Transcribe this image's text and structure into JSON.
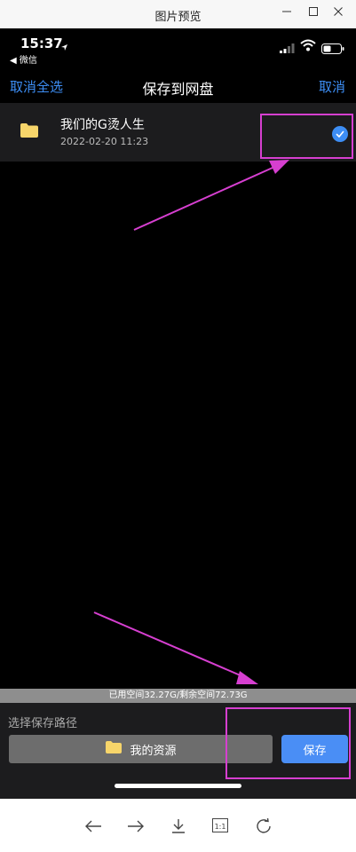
{
  "window": {
    "title": "图片预览"
  },
  "status_bar": {
    "time": "15:37",
    "back_app": "◀ 微信"
  },
  "nav": {
    "cancel_select_all": "取消全选",
    "title": "保存到网盘",
    "cancel": "取消"
  },
  "files": [
    {
      "name": "我们的G烫人生",
      "date": "2022-02-20 11:23",
      "selected": true,
      "icon": "folder-icon"
    }
  ],
  "storage": {
    "text": "已用空间32.27G/剩余空间72.73G"
  },
  "bottom": {
    "path_label": "选择保存路径",
    "path_value": "我的资源",
    "save_label": "保存"
  },
  "toolbar": {
    "items": [
      "back-arrow-icon",
      "forward-arrow-icon",
      "download-icon",
      "actual-size-icon",
      "rotate-icon"
    ],
    "actual_size_label": "1:1"
  },
  "colors": {
    "accent_blue": "#3d8ef5",
    "annotation_magenta": "#d63fd0",
    "folder_yellow": "#f7d56a"
  }
}
